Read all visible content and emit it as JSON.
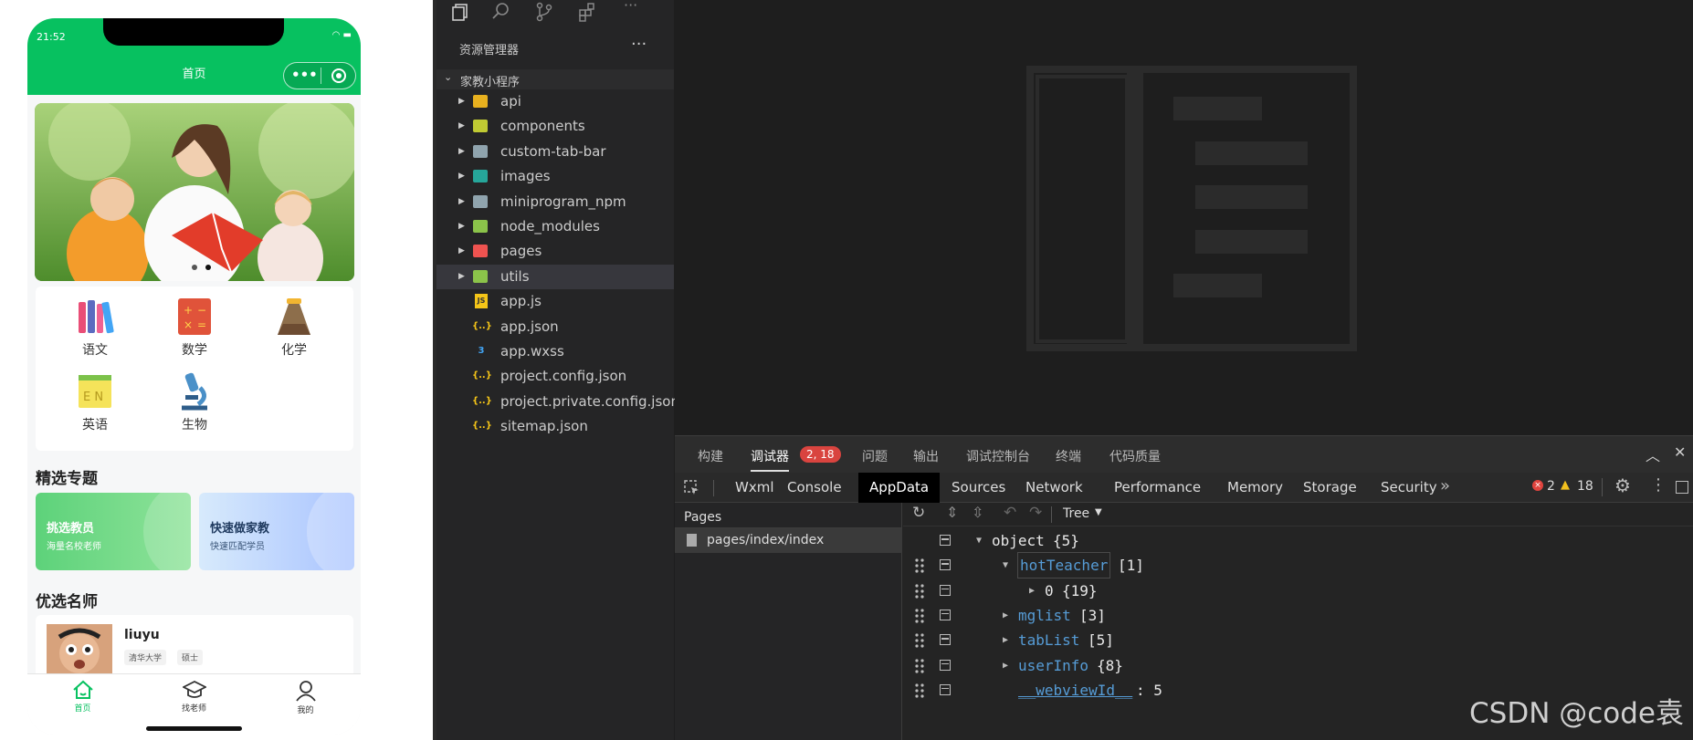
{
  "phone": {
    "time": "21:52",
    "nav_title": "首页",
    "subjects": [
      "语文",
      "数学",
      "化学",
      "英语",
      "生物"
    ],
    "section_featured": "精选专题",
    "promo1_title": "挑选教员",
    "promo1_sub": "海量名校老师",
    "promo2_title": "快速做家教",
    "promo2_sub": "快速匹配学员",
    "section_teachers": "优选名师",
    "teacher_name": "liuyu",
    "teacher_tags": [
      "清华大学",
      "硕士"
    ],
    "tabs": [
      "首页",
      "找老师",
      "我的"
    ],
    "colors": {
      "brand": "#07c160"
    }
  },
  "explorer": {
    "header": "资源管理器",
    "more": "···",
    "project": "家教小程序",
    "folders": [
      {
        "name": "api",
        "icon": "folder-api-icon",
        "color": "#e8b11f"
      },
      {
        "name": "components",
        "icon": "folder-components-icon",
        "color": "#c0ca33"
      },
      {
        "name": "custom-tab-bar",
        "icon": "folder-icon",
        "color": "#90a4ae"
      },
      {
        "name": "images",
        "icon": "folder-images-icon",
        "color": "#26a69a"
      },
      {
        "name": "miniprogram_npm",
        "icon": "folder-icon",
        "color": "#90a4ae"
      },
      {
        "name": "node_modules",
        "icon": "folder-node-icon",
        "color": "#8bc34a"
      },
      {
        "name": "pages",
        "icon": "folder-pages-icon",
        "color": "#ef5350"
      },
      {
        "name": "utils",
        "icon": "folder-utils-icon",
        "color": "#8bc34a"
      }
    ],
    "files": [
      {
        "name": "app.js",
        "icon": "js-file-icon",
        "glyph": "JS",
        "color": "#f5c518"
      },
      {
        "name": "app.json",
        "icon": "json-file-icon",
        "glyph": "{..}",
        "color": "#f5c518"
      },
      {
        "name": "app.wxss",
        "icon": "css-file-icon",
        "glyph": "3",
        "color": "#42a5f5"
      },
      {
        "name": "project.config.json",
        "icon": "json-file-icon",
        "glyph": "{..}",
        "color": "#f5c518"
      },
      {
        "name": "project.private.config.json",
        "icon": "json-file-icon",
        "glyph": "{..}",
        "color": "#f5c518"
      },
      {
        "name": "sitemap.json",
        "icon": "json-file-icon",
        "glyph": "{..}",
        "color": "#f5c518"
      }
    ]
  },
  "devtools": {
    "top_tabs": [
      "构建",
      "调试器",
      "问题",
      "输出",
      "调试控制台",
      "终端",
      "代码质量"
    ],
    "debugger_badge": "2, 18",
    "panel_tabs": [
      "Wxml",
      "Console",
      "AppData",
      "Sources",
      "Network",
      "Performance",
      "Memory",
      "Storage",
      "Security"
    ],
    "more_tabs": "»",
    "error_count": "2",
    "warning_count": "18",
    "pages_header": "Pages",
    "page_item": "pages/index/index",
    "view_mode": "Tree",
    "tree": [
      {
        "indent": 0,
        "arrow": "▼",
        "key": "object",
        "val": "{5}",
        "plain": true
      },
      {
        "indent": 1,
        "arrow": "▼",
        "key": "hotTeacher",
        "val": "[1]",
        "highlight": true
      },
      {
        "indent": 2,
        "arrow": "▶",
        "key": "0",
        "val": "{19}",
        "plain": true
      },
      {
        "indent": 1,
        "arrow": "▶",
        "key": "mglist",
        "val": "[3]"
      },
      {
        "indent": 1,
        "arrow": "▶",
        "key": "tabList",
        "val": "[5]"
      },
      {
        "indent": 1,
        "arrow": "▶",
        "key": "userInfo",
        "val": "{8}"
      },
      {
        "indent": 1,
        "arrow": "",
        "key": "__webviewId__",
        "val": ": 5",
        "underline": true
      }
    ]
  },
  "watermark": "CSDN @code袁"
}
